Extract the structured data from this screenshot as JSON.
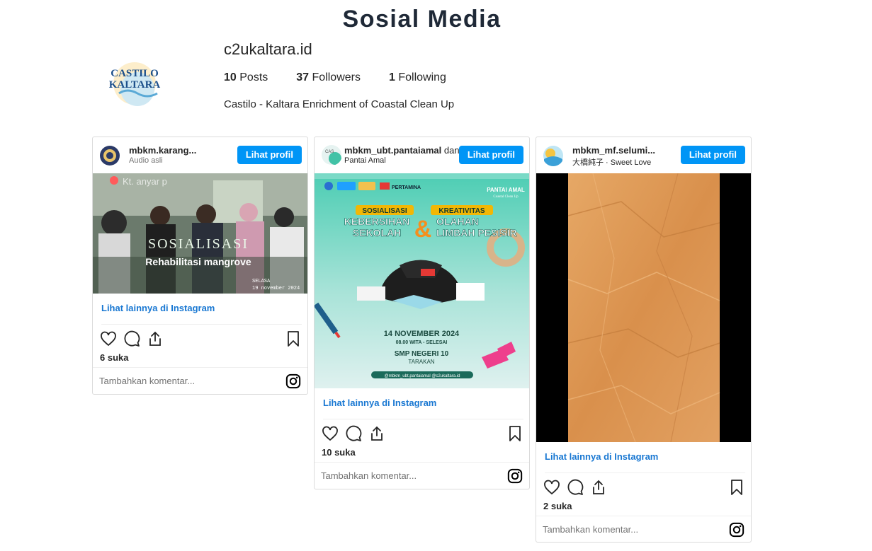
{
  "page": {
    "title": "Sosial Media"
  },
  "profile": {
    "username": "c2ukaltara.id",
    "posts_count": "10",
    "posts_label": "Posts",
    "followers_count": "37",
    "followers_label": "Followers",
    "following_count": "1",
    "following_label": "Following",
    "bio": "Castilo - Kaltara Enrichment of Coastal Clean Up",
    "logo_text_1": "CASTILO",
    "logo_text_2": "KALTARA"
  },
  "posts": [
    {
      "username": "mbkm.karang...",
      "subline": "Audio asli",
      "button_label": "Lihat profil",
      "media_texts": {
        "location": "Kt. anyar p",
        "headline": "SOSIALISASI",
        "subheadline": "Rehabilitasi mangrove",
        "day": "SELASA",
        "date": "19 november 2024"
      },
      "more_label": "Lihat lainnya di Instagram",
      "likes": "6 suka",
      "comment_placeholder": "Tambahkan komentar..."
    },
    {
      "username": "mbkm_ubt.pantaiamal",
      "username_suffix": "dan",
      "subline": "Pantai Amal",
      "button_label": "Lihat profil",
      "media_texts": {
        "sponsor": "PERTAMINA",
        "brand": "PANTAI AMAL",
        "brand_sub": "Coastal Clean Up",
        "label_1": "SOSIALISASI",
        "label_2": "KREATIVITAS",
        "line_1a": "KEBERSIHAN",
        "line_1b": "OLAHAN",
        "line_2a": "SEKOLAH",
        "line_2b": "LIMBAH PESISIR",
        "date": "14 NOVEMBER 2024",
        "time": "08.00 WITA - SELESAI",
        "venue": "SMP NEGERI 10",
        "city": "TARAKAN",
        "handles": "@mbkm_ubt.pantaiamal  @c2ukaltara.id"
      },
      "more_label": "Lihat lainnya di Instagram",
      "likes": "10 suka",
      "comment_placeholder": "Tambahkan komentar..."
    },
    {
      "username": "mbkm_mf.selumi...",
      "subline": "大橋純子 · Sweet Love",
      "button_label": "Lihat profil",
      "more_label": "Lihat lainnya di Instagram",
      "likes": "2 suka",
      "comment_placeholder": "Tambahkan komentar..."
    }
  ],
  "icons": [
    "heart-icon",
    "comment-icon",
    "share-icon",
    "bookmark-icon",
    "instagram-icon"
  ],
  "colors": {
    "button": "#0095f6",
    "link": "#1877d2",
    "title": "#1f2937"
  }
}
